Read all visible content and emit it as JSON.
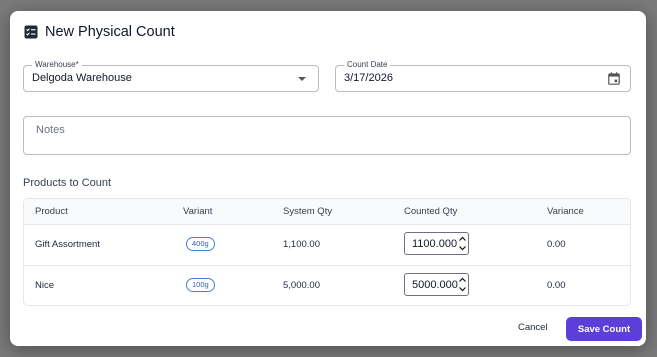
{
  "dialog": {
    "title": "New Physical Count",
    "icon": "checklist-icon"
  },
  "warehouse": {
    "label": "Warehouse*",
    "value": "Delgoda Warehouse"
  },
  "count_date": {
    "label": "Count Date",
    "value": "3/17/2026"
  },
  "notes": {
    "placeholder": "Notes"
  },
  "products": {
    "section_label": "Products to Count",
    "columns": [
      "Product",
      "Variant",
      "System Qty",
      "Counted Qty",
      "Variance"
    ],
    "rows": [
      {
        "product": "Gift Assortment",
        "variant": "400g",
        "system_qty": "1,100.00",
        "counted_qty": "1100.000",
        "variance": "0.00"
      },
      {
        "product": "Nice",
        "variant": "100g",
        "system_qty": "5,000.00",
        "counted_qty": "5000.000",
        "variance": "0.00"
      }
    ]
  },
  "actions": {
    "cancel_label": "Cancel",
    "save_label": "Save Count"
  },
  "colors": {
    "primary": "#5b3fd8",
    "chip_border": "#4a7fd6"
  }
}
